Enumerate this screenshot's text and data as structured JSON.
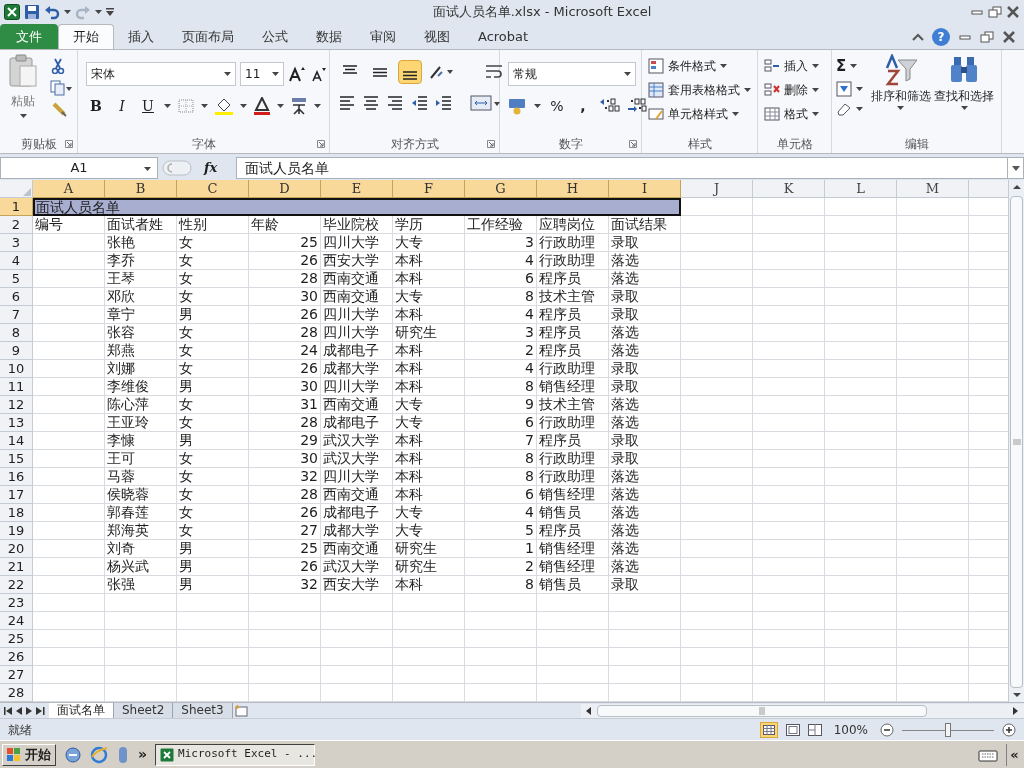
{
  "window": {
    "title": "面试人员名单.xlsx - Microsoft Excel"
  },
  "tabs": [
    {
      "label": "文件",
      "kind": "file",
      "selected": false
    },
    {
      "label": "开始",
      "kind": "tab",
      "selected": true
    },
    {
      "label": "插入",
      "kind": "tab",
      "selected": false
    },
    {
      "label": "页面布局",
      "kind": "tab",
      "selected": false
    },
    {
      "label": "公式",
      "kind": "tab",
      "selected": false
    },
    {
      "label": "数据",
      "kind": "tab",
      "selected": false
    },
    {
      "label": "审阅",
      "kind": "tab",
      "selected": false
    },
    {
      "label": "视图",
      "kind": "tab",
      "selected": false
    },
    {
      "label": "Acrobat",
      "kind": "tab",
      "selected": false
    }
  ],
  "help": "?",
  "ribbon": {
    "clipboard": {
      "paste": "粘贴",
      "label": "剪贴板"
    },
    "font": {
      "name": "宋体",
      "size": "11",
      "bold": "B",
      "italic": "I",
      "underline": "U",
      "label": "字体"
    },
    "alignment": {
      "vertical_buttons": [
        {
          "selected": false
        },
        {
          "selected": false
        },
        {
          "selected": true
        }
      ],
      "label": "对齐方式"
    },
    "number": {
      "format": "常规",
      "percent": "%",
      "comma": ",",
      "label": "数字"
    },
    "styles": {
      "items": [
        "条件格式",
        "套用表格格式",
        "单元格样式"
      ],
      "label": "样式"
    },
    "cells": {
      "items": [
        "插入",
        "删除",
        "格式"
      ],
      "label": "单元格"
    },
    "editing": {
      "sum": "Σ",
      "sort": "排序和筛选",
      "find": "查找和选择",
      "label": "编辑"
    }
  },
  "formula_bar": {
    "name_box": "A1",
    "fx": "fx",
    "value": "面试人员名单"
  },
  "columns": [
    {
      "letter": "A",
      "selected": true
    },
    {
      "letter": "B",
      "selected": true
    },
    {
      "letter": "C",
      "selected": true
    },
    {
      "letter": "D",
      "selected": true
    },
    {
      "letter": "E",
      "selected": true
    },
    {
      "letter": "F",
      "selected": true
    },
    {
      "letter": "G",
      "selected": true
    },
    {
      "letter": "H",
      "selected": true
    },
    {
      "letter": "I",
      "selected": true
    },
    {
      "letter": "J",
      "selected": false
    },
    {
      "letter": "K",
      "selected": false
    },
    {
      "letter": "L",
      "selected": false
    },
    {
      "letter": "M",
      "selected": false
    }
  ],
  "rows": [
    {
      "number": "1",
      "selected": true,
      "title": "面试人员名单"
    },
    {
      "number": "2",
      "selected": false,
      "cells": [
        "编号",
        "面试者姓",
        "性别",
        "年龄",
        "毕业院校",
        "学历",
        "工作经验",
        "应聘岗位",
        "面试结果"
      ]
    },
    {
      "number": "3",
      "selected": false,
      "cells": [
        "",
        "张艳",
        "女",
        "25",
        "四川大学",
        "大专",
        "3",
        "行政助理",
        "录取"
      ]
    },
    {
      "number": "4",
      "selected": false,
      "cells": [
        "",
        "李乔",
        "女",
        "26",
        "西安大学",
        "本科",
        "4",
        "行政助理",
        "落选"
      ]
    },
    {
      "number": "5",
      "selected": false,
      "cells": [
        "",
        "王琴",
        "女",
        "28",
        "西南交通",
        "本科",
        "6",
        "程序员",
        "落选"
      ]
    },
    {
      "number": "6",
      "selected": false,
      "cells": [
        "",
        "邓欣",
        "女",
        "30",
        "西南交通",
        "大专",
        "8",
        "技术主管",
        "录取"
      ]
    },
    {
      "number": "7",
      "selected": false,
      "cells": [
        "",
        "章宁",
        "男",
        "26",
        "四川大学",
        "本科",
        "4",
        "程序员",
        "录取"
      ]
    },
    {
      "number": "8",
      "selected": false,
      "cells": [
        "",
        "张容",
        "女",
        "28",
        "四川大学",
        "研究生",
        "3",
        "程序员",
        "落选"
      ]
    },
    {
      "number": "9",
      "selected": false,
      "cells": [
        "",
        "郑燕",
        "女",
        "24",
        "成都电子",
        "本科",
        "2",
        "程序员",
        "落选"
      ]
    },
    {
      "number": "10",
      "selected": false,
      "cells": [
        "",
        "刘娜",
        "女",
        "26",
        "成都大学",
        "本科",
        "4",
        "行政助理",
        "录取"
      ]
    },
    {
      "number": "11",
      "selected": false,
      "cells": [
        "",
        "李维俊",
        "男",
        "30",
        "四川大学",
        "本科",
        "8",
        "销售经理",
        "录取"
      ]
    },
    {
      "number": "12",
      "selected": false,
      "cells": [
        "",
        "陈心萍",
        "女",
        "31",
        "西南交通",
        "大专",
        "9",
        "技术主管",
        "落选"
      ]
    },
    {
      "number": "13",
      "selected": false,
      "cells": [
        "",
        "王亚玲",
        "女",
        "28",
        "成都电子",
        "大专",
        "6",
        "行政助理",
        "落选"
      ]
    },
    {
      "number": "14",
      "selected": false,
      "cells": [
        "",
        "李慷",
        "男",
        "29",
        "武汉大学",
        "本科",
        "7",
        "程序员",
        "录取"
      ]
    },
    {
      "number": "15",
      "selected": false,
      "cells": [
        "",
        "王可",
        "女",
        "30",
        "武汉大学",
        "本科",
        "8",
        "行政助理",
        "录取"
      ]
    },
    {
      "number": "16",
      "selected": false,
      "cells": [
        "",
        "马蓉",
        "女",
        "32",
        "四川大学",
        "本科",
        "8",
        "行政助理",
        "落选"
      ]
    },
    {
      "number": "17",
      "selected": false,
      "cells": [
        "",
        "侯晓蓉",
        "女",
        "28",
        "西南交通",
        "本科",
        "6",
        "销售经理",
        "落选"
      ]
    },
    {
      "number": "18",
      "selected": false,
      "cells": [
        "",
        "郭春莲",
        "女",
        "26",
        "成都电子",
        "大专",
        "4",
        "销售员",
        "落选"
      ]
    },
    {
      "number": "19",
      "selected": false,
      "cells": [
        "",
        "郑海英",
        "女",
        "27",
        "成都大学",
        "大专",
        "5",
        "程序员",
        "落选"
      ]
    },
    {
      "number": "20",
      "selected": false,
      "cells": [
        "",
        "刘奇",
        "男",
        "25",
        "西南交通",
        "研究生",
        "1",
        "销售经理",
        "落选"
      ]
    },
    {
      "number": "21",
      "selected": false,
      "cells": [
        "",
        "杨兴武",
        "男",
        "26",
        "武汉大学",
        "研究生",
        "2",
        "销售经理",
        "落选"
      ]
    },
    {
      "number": "22",
      "selected": false,
      "cells": [
        "",
        "张强",
        "男",
        "32",
        "西安大学",
        "本科",
        "8",
        "销售员",
        "录取"
      ]
    },
    {
      "number": "23",
      "selected": false
    },
    {
      "number": "24",
      "selected": false
    },
    {
      "number": "25",
      "selected": false
    },
    {
      "number": "26",
      "selected": false
    },
    {
      "number": "27",
      "selected": false
    },
    {
      "number": "28",
      "selected": false
    }
  ],
  "sheet_tabs": [
    {
      "label": "面试名单",
      "selected": true
    },
    {
      "label": "Sheet2",
      "selected": false
    },
    {
      "label": "Sheet3",
      "selected": false
    }
  ],
  "status_bar": {
    "text": "就绪",
    "zoom": "100%",
    "zoom_slider": {
      "level": 0.5
    }
  },
  "taskbar": {
    "start": "开始",
    "more": "»",
    "tasks": [
      {
        "label": "Microsoft Excel - ...",
        "selected": true
      }
    ],
    "collapse": "«"
  }
}
